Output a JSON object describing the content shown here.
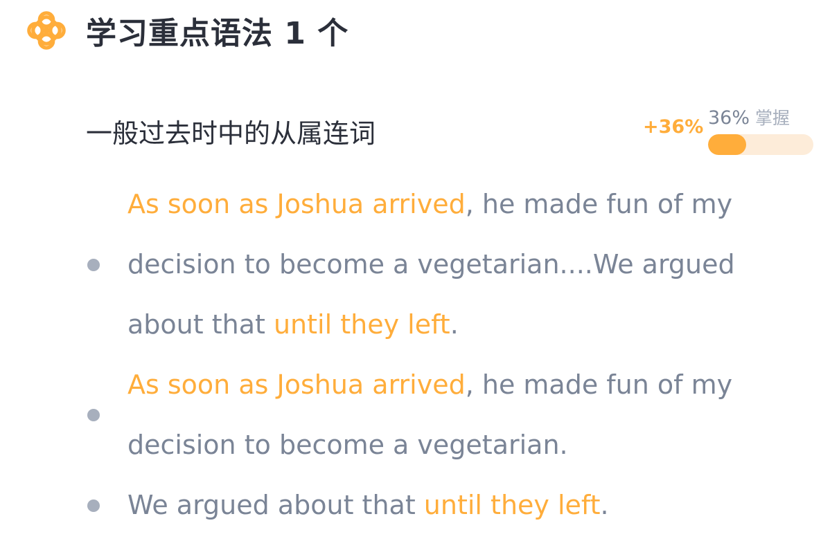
{
  "colors": {
    "accent": "#ffad3b",
    "title_text": "#2b2f3a",
    "body_text": "#7a8496",
    "muted": "#a7afbd",
    "track": "#fdecd9"
  },
  "header": {
    "icon": "flower-knot-icon",
    "title": "学习重点语法 1 个"
  },
  "grammar": {
    "title": "一般过去时中的从属连词",
    "gain": "+36%",
    "mastery_percent_text": "36%",
    "mastery_label": "掌握",
    "mastery_fraction": 0.36
  },
  "examples": [
    {
      "parts": [
        {
          "text": "As soon as Joshua arrived",
          "highlight": true
        },
        {
          "text": ", he made fun of my decision to become a vegetarian....We argued about that ",
          "highlight": false
        },
        {
          "text": "until they left",
          "highlight": true
        },
        {
          "text": ".",
          "highlight": false
        }
      ]
    },
    {
      "parts": [
        {
          "text": "As soon as Joshua arrived",
          "highlight": true
        },
        {
          "text": ", he made fun of my decision to become a vegetarian.",
          "highlight": false
        }
      ]
    },
    {
      "parts": [
        {
          "text": "We argued about that ",
          "highlight": false
        },
        {
          "text": "until they left",
          "highlight": true
        },
        {
          "text": ".",
          "highlight": false
        }
      ]
    }
  ]
}
